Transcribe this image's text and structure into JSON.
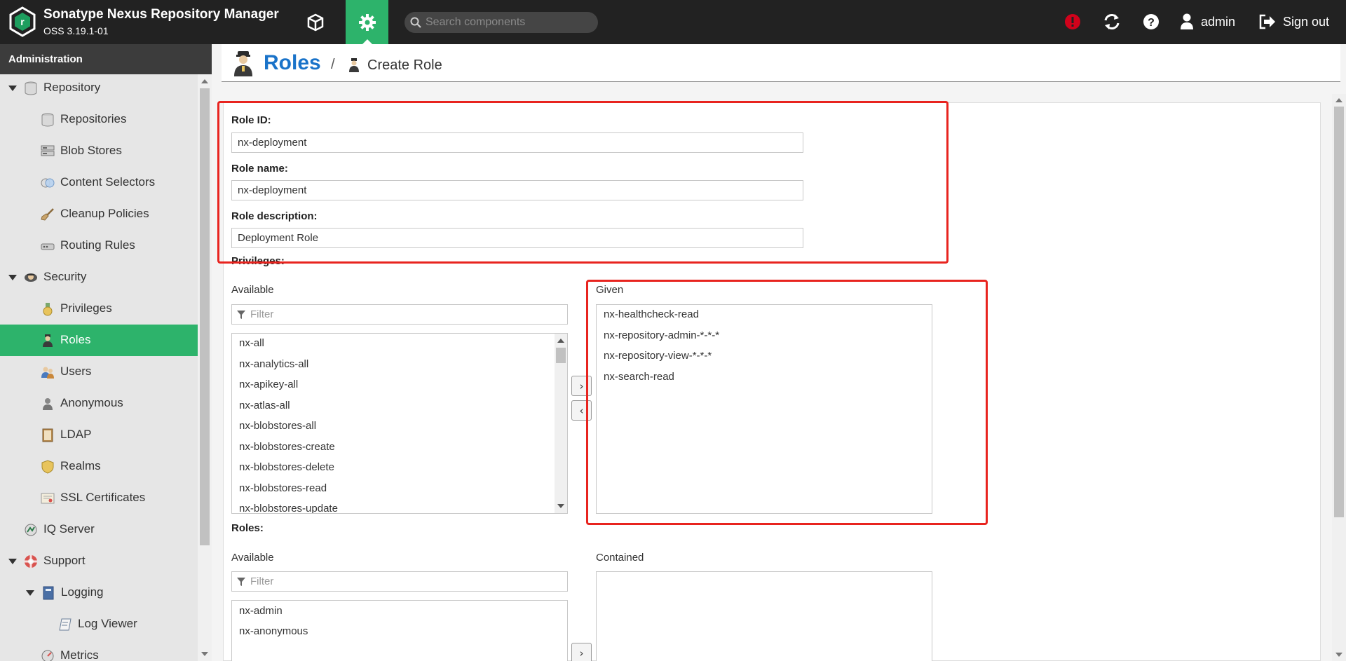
{
  "app": {
    "title": "Sonatype Nexus Repository Manager",
    "version": "OSS 3.19.1-01"
  },
  "header": {
    "search_placeholder": "Search components",
    "user": "admin",
    "signout": "Sign out",
    "alert_color": "#d0021b",
    "accent": "#2db36b"
  },
  "sidebar": {
    "title": "Administration",
    "items": [
      {
        "label": "Repository",
        "icon": "database-icon"
      },
      {
        "label": "Repositories",
        "icon": "database-icon"
      },
      {
        "label": "Blob Stores",
        "icon": "server-icon"
      },
      {
        "label": "Content Selectors",
        "icon": "selector-icon"
      },
      {
        "label": "Cleanup Policies",
        "icon": "broom-icon"
      },
      {
        "label": "Routing Rules",
        "icon": "router-icon"
      },
      {
        "label": "Security",
        "icon": "security-icon"
      },
      {
        "label": "Privileges",
        "icon": "medal-icon"
      },
      {
        "label": "Roles",
        "icon": "role-icon"
      },
      {
        "label": "Users",
        "icon": "users-icon"
      },
      {
        "label": "Anonymous",
        "icon": "anonymous-icon"
      },
      {
        "label": "LDAP",
        "icon": "book-icon"
      },
      {
        "label": "Realms",
        "icon": "shield-icon"
      },
      {
        "label": "SSL Certificates",
        "icon": "certificate-icon"
      },
      {
        "label": "IQ Server",
        "icon": "iq-icon"
      },
      {
        "label": "Support",
        "icon": "lifebuoy-icon"
      },
      {
        "label": "Logging",
        "icon": "logbook-icon"
      },
      {
        "label": "Log Viewer",
        "icon": "log-viewer-icon"
      },
      {
        "label": "Metrics",
        "icon": "metrics-icon"
      }
    ]
  },
  "breadcrumb": {
    "main": "Roles",
    "separator": "/",
    "sub": "Create Role"
  },
  "form": {
    "role_id_label": "Role ID:",
    "role_id_value": "nx-deployment",
    "role_name_label": "Role name:",
    "role_name_value": "nx-deployment",
    "role_desc_label": "Role description:",
    "role_desc_value": "Deployment Role",
    "privileges_label": "Privileges:",
    "available_label": "Available",
    "given_label": "Given",
    "filter_placeholder": "Filter",
    "available_privileges": [
      "nx-all",
      "nx-analytics-all",
      "nx-apikey-all",
      "nx-atlas-all",
      "nx-blobstores-all",
      "nx-blobstores-create",
      "nx-blobstores-delete",
      "nx-blobstores-read",
      "nx-blobstores-update"
    ],
    "given_privileges": [
      "nx-healthcheck-read",
      "nx-repository-admin-*-*-*",
      "nx-repository-view-*-*-*",
      "nx-search-read"
    ],
    "add_symbol": "›",
    "remove_symbol": "‹",
    "roles_label": "Roles:",
    "roles_available_label": "Available",
    "contained_label": "Contained",
    "available_roles": [
      "nx-admin",
      "nx-anonymous"
    ],
    "highlight_color": "#e8241f"
  }
}
